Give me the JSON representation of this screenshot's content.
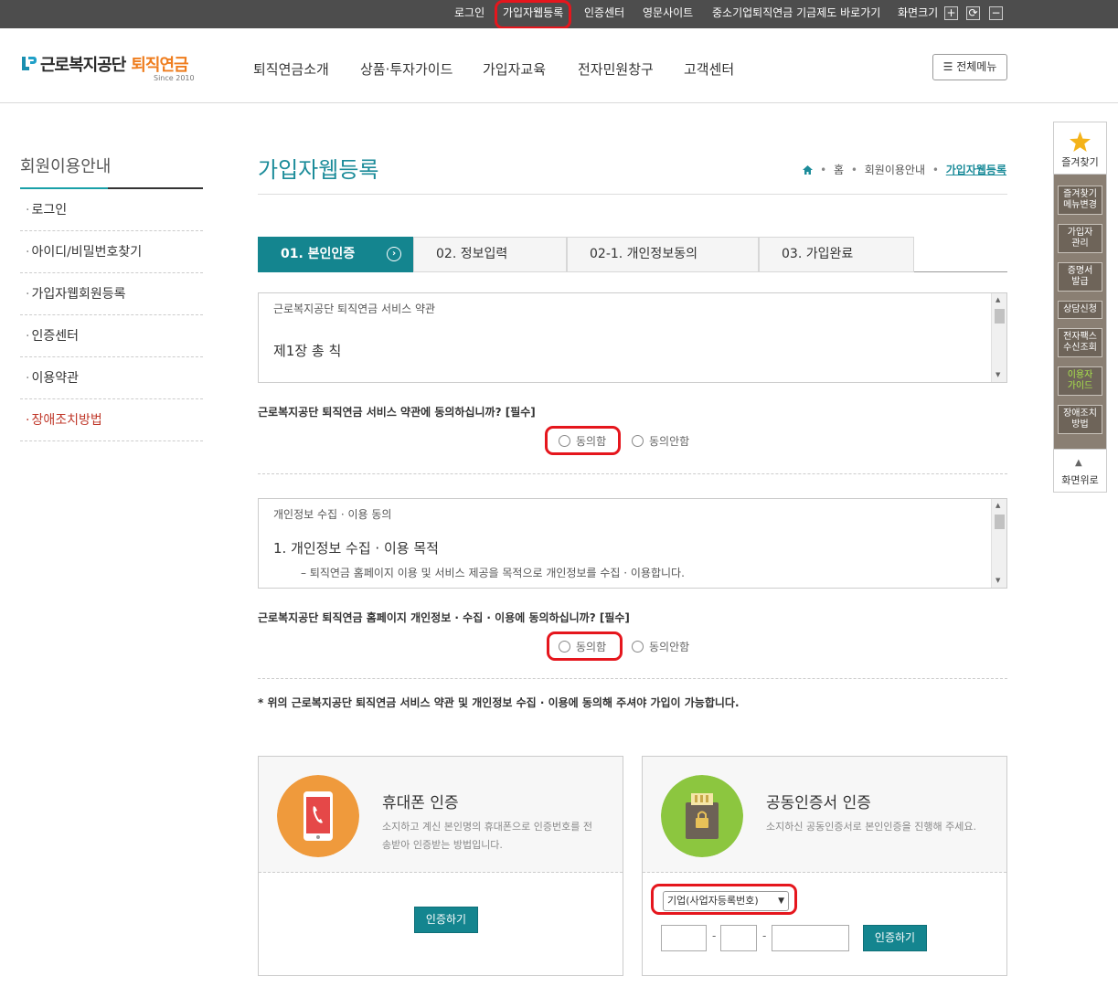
{
  "utility": {
    "login": "로그인",
    "web_register": "가입자웹등록",
    "cert_center": "인증센터",
    "english": "영문사이트",
    "sme_fund": "중소기업퇴직연금 기금제도 바로가기",
    "screen_size": "화면크기",
    "zoom_in": "+",
    "reset": "⟳",
    "zoom_out": "−"
  },
  "header": {
    "logo_main": "근로복지공단",
    "logo_accent": "퇴직연금",
    "logo_sub": "Since 2010",
    "nav": [
      "퇴직연금소개",
      "상품·투자가이드",
      "가입자교육",
      "전자민원창구",
      "고객센터"
    ],
    "all_menu": "☰ 전체메뉴"
  },
  "sidebar": {
    "title": "회원이용안내",
    "items": [
      {
        "label": "로그인"
      },
      {
        "label": "아이디/비밀번호찾기"
      },
      {
        "label": "가입자웹회원등록"
      },
      {
        "label": "인증센터"
      },
      {
        "label": "이용약관"
      },
      {
        "label": "장애조치방법"
      }
    ],
    "active_index": 5
  },
  "page": {
    "title": "가입자웹등록",
    "breadcrumb": [
      "홈",
      "회원이용안내",
      "가입자웹등록"
    ]
  },
  "steps": [
    {
      "label": "01. 본인인증",
      "active": true
    },
    {
      "label": "02. 정보입력",
      "active": false
    },
    {
      "label": "02-1. 개인정보동의",
      "active": false
    },
    {
      "label": "03. 가입완료",
      "active": false
    }
  ],
  "terms1": {
    "heading": "근로복지공단 퇴직연금 서비스 약관",
    "chapter": "제1장 총 칙",
    "question": "근로복지공단 퇴직연금 서비스 약관에 동의하십니까? [필수]",
    "agree": "동의함",
    "disagree": "동의안함"
  },
  "terms2": {
    "heading": "개인정보 수집 · 이용 동의",
    "chapter": "1. 개인정보 수집 · 이용 목적",
    "body": "– 퇴직연금 홈페이지 이용 및 서비스 제공을 목적으로 개인정보를 수집 · 이용합니다.",
    "question": "근로복지공단 퇴직연금 홈페이지 개인정보 · 수집 · 이용에 동의하십니까? [필수]",
    "agree": "동의함",
    "disagree": "동의안함"
  },
  "notice": "* 위의 근로복지공단 퇴직연금 서비스 약관 및 개인정보 수집 · 이용에 동의해 주셔야 가입이 가능합니다.",
  "phone_auth": {
    "title": "휴대폰 인증",
    "desc": "소지하고 계신 본인명의 휴대폰으로 인증번호를 전송받아 인증받는 방법입니다.",
    "button": "인증하기"
  },
  "cert_auth": {
    "title": "공동인증서 인증",
    "desc": "소지하신 공동인증서로 본인인증을 진행해 주세요.",
    "select_value": "기업(사업자등록번호)",
    "dash": "-",
    "button": "인증하기"
  },
  "quick_menu": {
    "favorites": "즐겨찾기",
    "items": [
      {
        "label": "즐겨찾기\n메뉴변경"
      },
      {
        "label": "가입자\n관리"
      },
      {
        "label": "증명서\n발급"
      },
      {
        "label": "상담신청"
      },
      {
        "label": "전자팩스\n수신조회"
      },
      {
        "label": "이용자\n가이드"
      },
      {
        "label": "장애조치\n방법"
      }
    ],
    "top": "화면위로"
  },
  "colors": {
    "teal": "#14858f",
    "orange_logo": "#ef7d1e",
    "highlight_red": "#e5161d"
  }
}
